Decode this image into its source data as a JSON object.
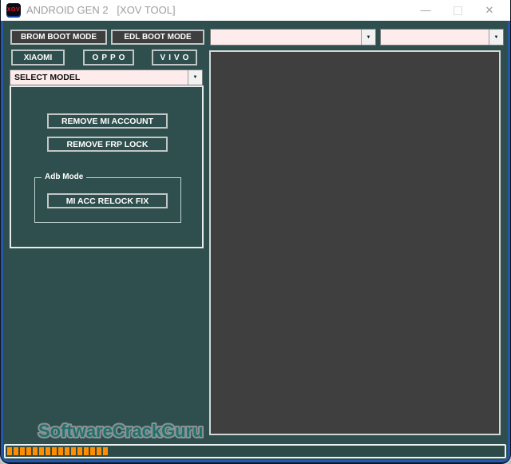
{
  "window": {
    "title": "ANDROID GEN 2   [XOV TOOL]",
    "icon_text": "XOV",
    "controls": {
      "minimize": "—",
      "maximize": "",
      "close": "✕"
    }
  },
  "icons": {
    "dropdown_arrow": "▼"
  },
  "toolbar": {
    "brom_button": "BROM BOOT MODE",
    "edl_button": "EDL BOOT MODE",
    "port_combo_value": "",
    "connection_combo_value": ""
  },
  "brands": {
    "xiaomi": "XIAOMI",
    "oppo": "OPPO",
    "vivo": "VIVO"
  },
  "model_select": {
    "value": "SELECT MODEL"
  },
  "actions": {
    "remove_mi_account": "REMOVE MI ACCOUNT",
    "remove_frp_lock": "REMOVE FRP LOCK",
    "adb_group_label": "Adb Mode",
    "mi_acc_relock_fix": "MI ACC RELOCK FIX"
  },
  "log_panel": {
    "content": ""
  },
  "watermark": {
    "text": "SoftwareCrackGuru"
  },
  "progress": {
    "filled_segments": 16
  },
  "colors": {
    "background_teal": "#2e4f4d",
    "dark_button": "#3e3e3e",
    "combo_pink": "#fdeceb",
    "progress_orange": "#ff8f00",
    "frame_blue": "#2457a7",
    "titlebar_white": "#ffffff"
  }
}
